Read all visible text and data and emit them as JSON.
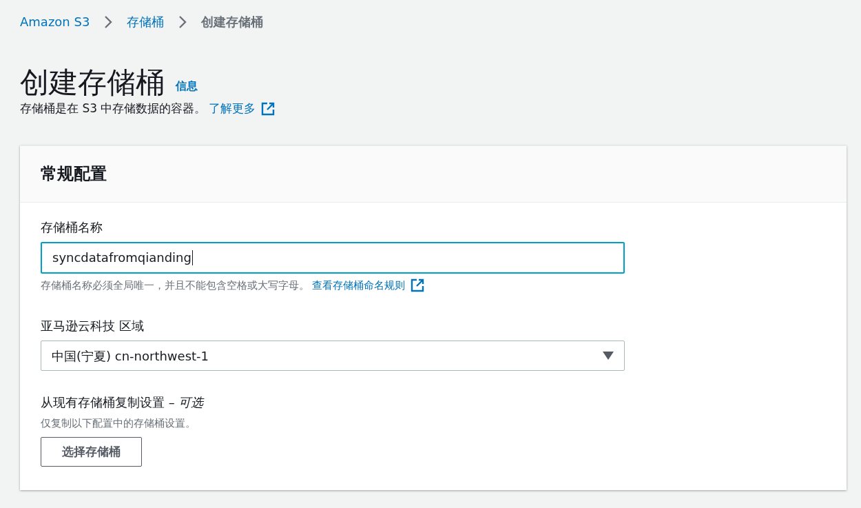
{
  "breadcrumb": [
    {
      "label": "Amazon S3",
      "current": false
    },
    {
      "label": "存储桶",
      "current": false
    },
    {
      "label": "创建存储桶",
      "current": true
    }
  ],
  "page": {
    "title": "创建存储桶",
    "info_link": "信息",
    "description": "存储桶是在 S3 中存储数据的容器。",
    "learn_more": "了解更多"
  },
  "panel": {
    "title": "常规配置",
    "bucket_name": {
      "label": "存储桶名称",
      "value": "syncdatafromqianding",
      "focused": true,
      "hint": "存储桶名称必须全局唯一，并且不能包含空格或大写字母。",
      "hint_link": "查看存储桶命名规则"
    },
    "region": {
      "label": "亚马逊云科技 区域",
      "value": "中国(宁夏) cn-northwest-1"
    },
    "copy_settings": {
      "label": "从现有存储桶复制设置 – *可选*",
      "description": "仅复制以下配置中的存储桶设置。",
      "button": "选择存储桶"
    }
  }
}
